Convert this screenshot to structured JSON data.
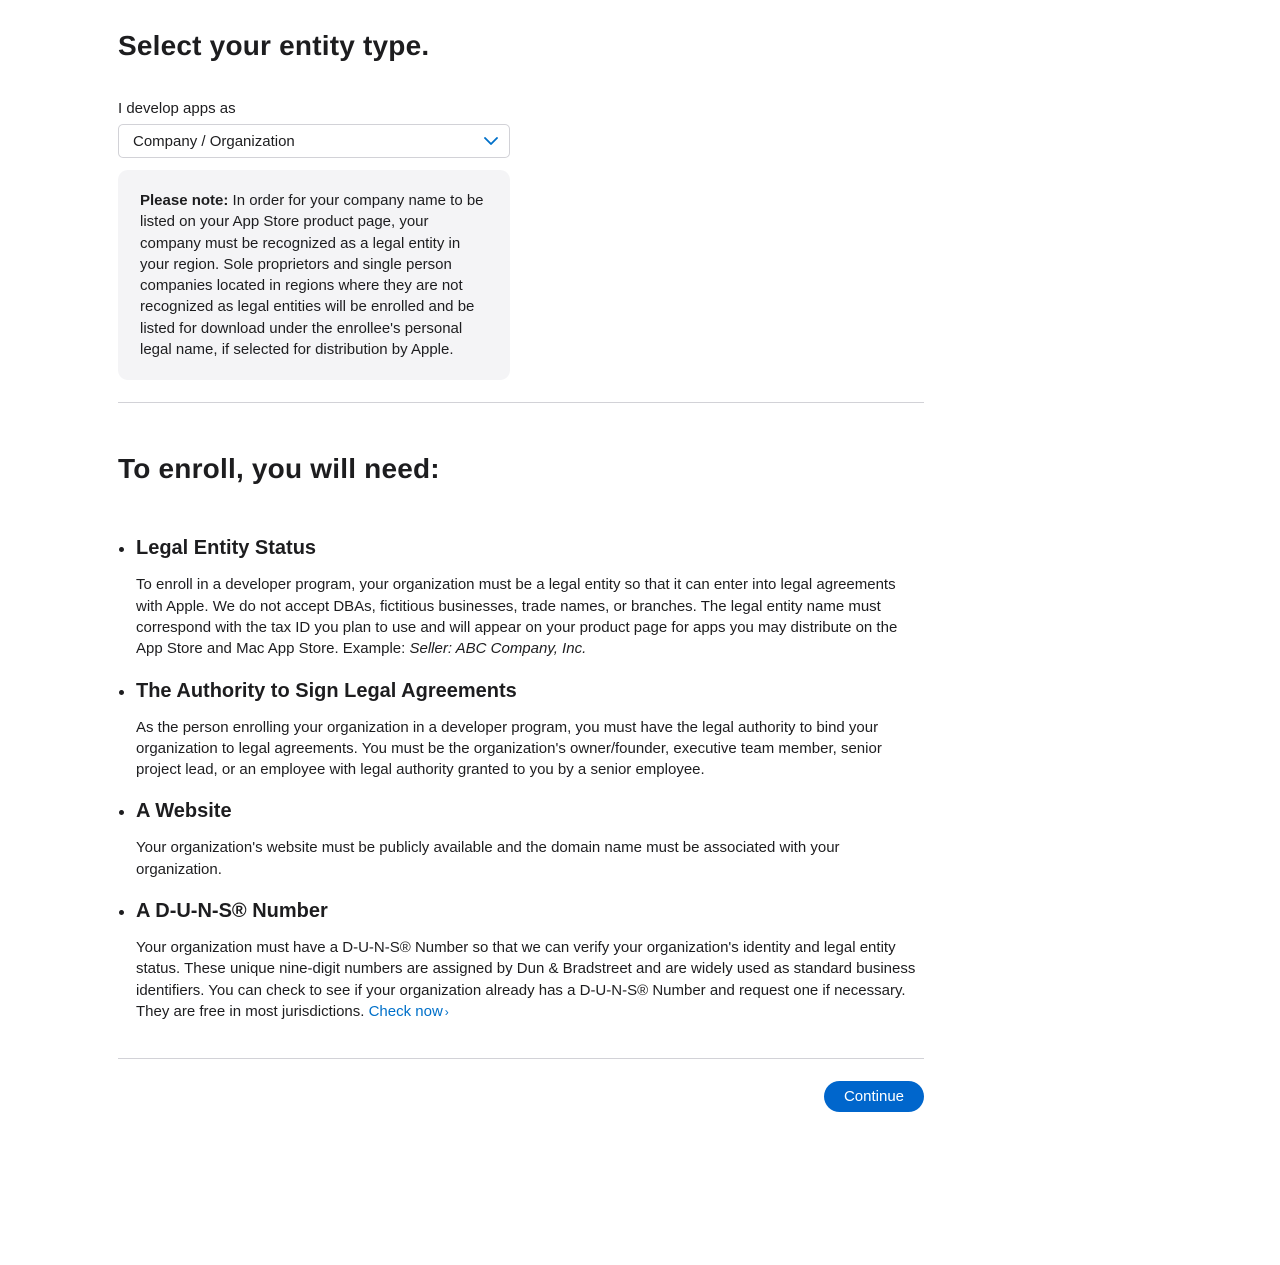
{
  "page_title": "Select your entity type.",
  "entity_select": {
    "label": "I develop apps as",
    "selected": "Company / Organization"
  },
  "note": {
    "label": "Please note:",
    "body": " In order for your company name to be listed on your App Store product page, your company must be recognized as a legal entity in your region. Sole proprietors and single person companies located in regions where they are not recognized as legal entities will be enrolled and be listed for download under the enrollee's personal legal name, if selected for distribution by Apple."
  },
  "section_title": "To enroll, you will need:",
  "requirements": [
    {
      "heading": "Legal Entity Status",
      "body_prefix": "To enroll in a developer program, your organization must be a legal entity so that it can enter into legal agreements with Apple. We do not accept DBAs, fictitious businesses, trade names, or branches. The legal entity name must correspond with the tax ID you plan to use and will appear on your product page for apps you may distribute on the App Store and Mac App Store. Example: ",
      "body_italic": "Seller: ABC Company, Inc."
    },
    {
      "heading": "The Authority to Sign Legal Agreements",
      "body": "As the person enrolling your organization in a developer program, you must have the legal authority to bind your organization to legal agreements. You must be the organization's owner/founder, executive team member, senior project lead, or an employee with legal authority granted to you by a senior employee."
    },
    {
      "heading": "A Website",
      "body": "Your organization's website must be publicly available and the domain name must be associated with your organization."
    },
    {
      "heading": "A D-U-N-S® Number",
      "body_prefix": "Your organization must have a D-U-N-S® Number so that we can verify your organization's identity and legal entity status. These unique nine-digit numbers are assigned by Dun & Bradstreet and are widely used as standard business identifiers. You can check to see if your organization already has a D-U-N-S® Number and request one if necessary. They are free in most jurisdictions. ",
      "link_text": "Check now"
    }
  ],
  "continue_button": "Continue"
}
